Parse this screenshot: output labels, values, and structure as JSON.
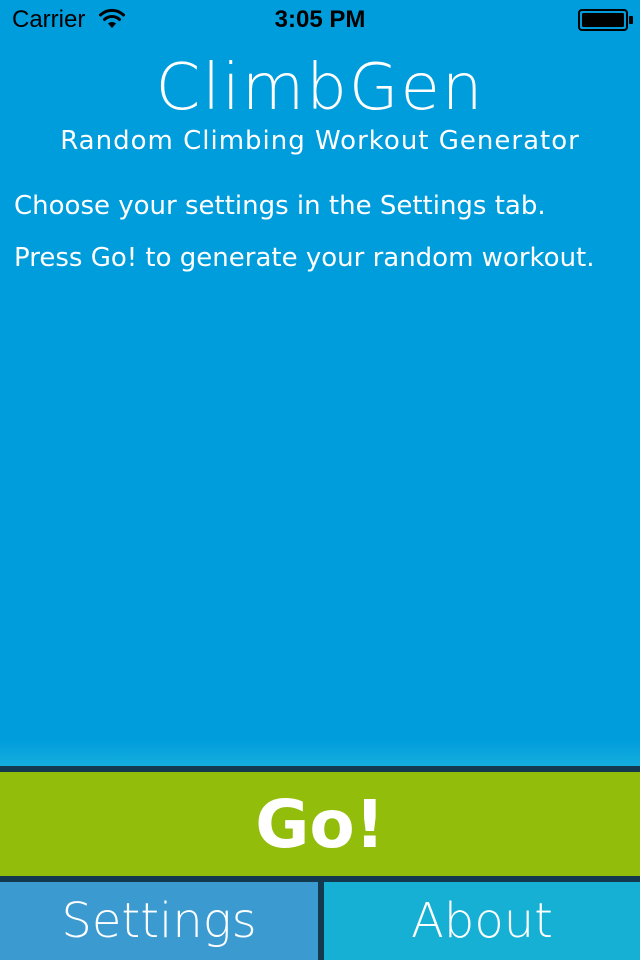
{
  "status_bar": {
    "carrier": "Carrier",
    "time": "3:05 PM",
    "wifi_icon": "wifi-icon",
    "battery_icon": "battery-icon"
  },
  "header": {
    "title": "ClimbGen",
    "subtitle": "Random Climbing Workout Generator"
  },
  "main": {
    "instructions": [
      "Choose your settings in the Settings tab.",
      "Press Go! to generate your random workout."
    ]
  },
  "go_button": {
    "label": "Go!"
  },
  "tabs": [
    {
      "label": "Settings"
    },
    {
      "label": "About"
    }
  ],
  "colors": {
    "background": "#009ddd",
    "go_button": "#92bd0b",
    "settings_tab": "#3b9bd1",
    "about_tab": "#15b0d3",
    "divider": "#13394f"
  }
}
